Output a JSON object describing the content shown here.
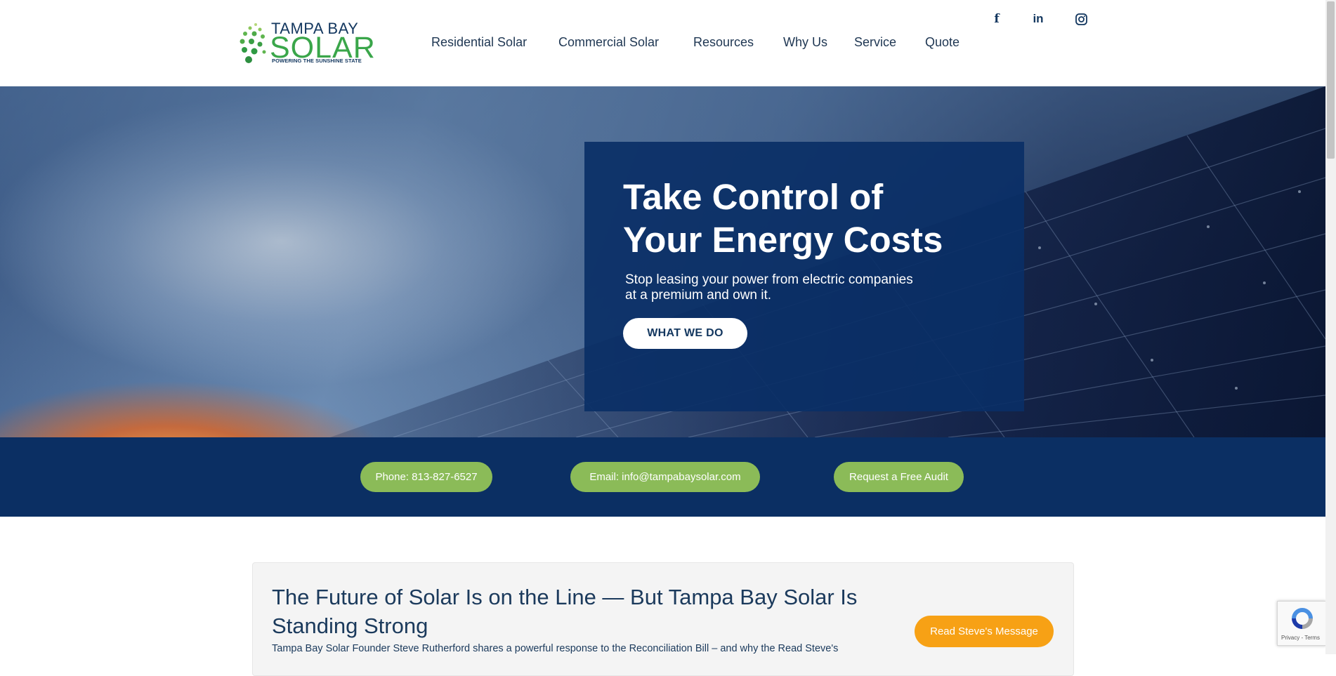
{
  "logo": {
    "line1": "TAMPA BAY",
    "line2": "SOLAR",
    "tagline": "POWERING THE SUNSHINE STATE"
  },
  "nav": {
    "items": [
      "Residential Solar",
      "Commercial Solar",
      "Resources",
      "Why Us",
      "Service",
      "Quote"
    ]
  },
  "social": {
    "facebook": "f",
    "linkedin": "in"
  },
  "hero": {
    "title_line1": "Take Control of",
    "title_line2": "Your Energy Costs",
    "subtitle_line1": "Stop leasing your power from electric companies",
    "subtitle_line2": "at a premium and own it.",
    "button": "WHAT WE DO"
  },
  "contact": {
    "phone": "Phone: 813-827-6527",
    "email": "Email: info@tampabaysolar.com",
    "audit": "Request a Free Audit"
  },
  "notice": {
    "title_line1": "The Future of Solar Is on the Line — But Tampa Bay Solar Is",
    "title_line2": "Standing Strong",
    "text": "Tampa Bay Solar Founder Steve Rutherford shares a powerful response to the Reconciliation Bill – and why the Read Steve's",
    "button": "Read Steve's Message"
  },
  "recaptcha": {
    "links": "Privacy - Terms"
  },
  "colors": {
    "navy": "#0b2f63",
    "green_button": "#8bbb58",
    "orange_button": "#f7a115",
    "logo_green": "#3aa64a"
  }
}
